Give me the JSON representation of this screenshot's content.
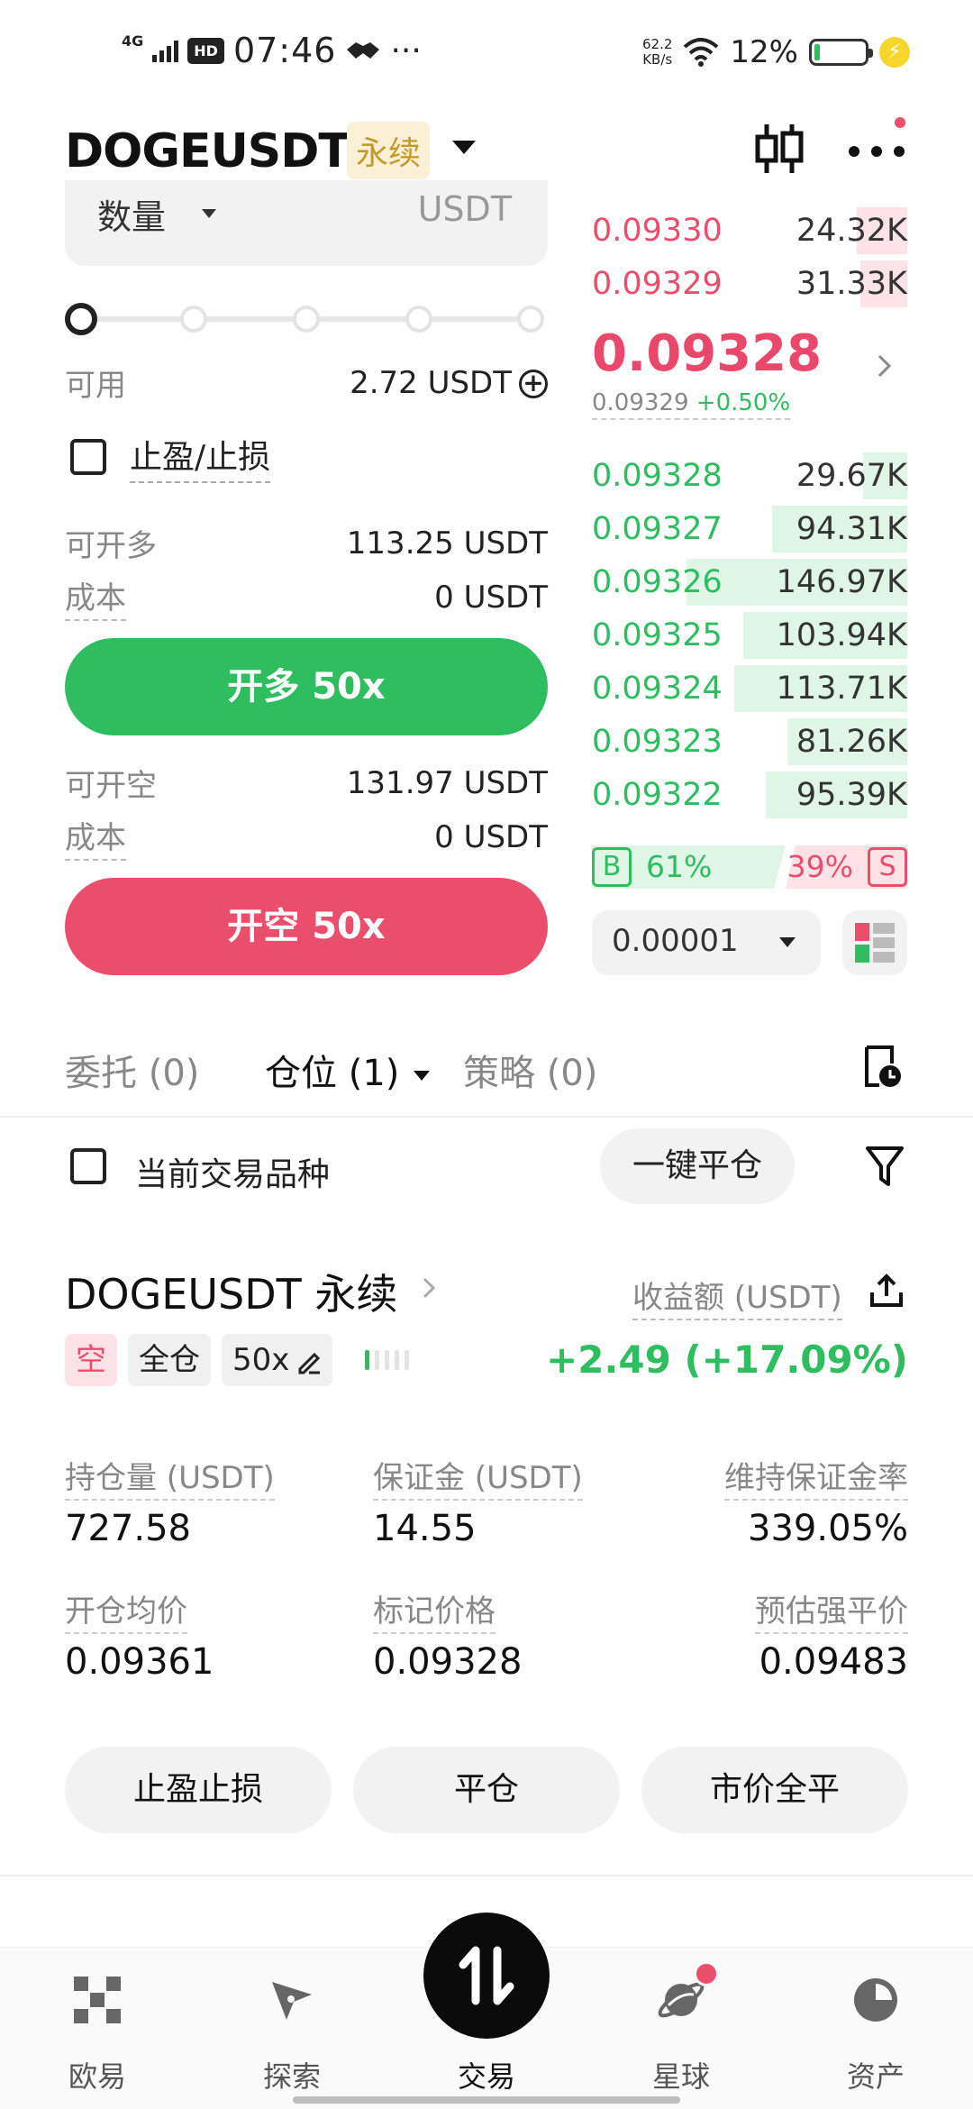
{
  "status_bar": {
    "network": "4G",
    "hd": "HD",
    "time": "07:46",
    "more": "···",
    "speed_value": "62.2",
    "speed_unit": "KB/s",
    "battery_pct": "12%",
    "battery_level": 0.12,
    "icons": [
      "signal-icon",
      "hd-icon",
      "handshake-icon",
      "wifi-icon",
      "battery-icon",
      "charging-icon"
    ]
  },
  "header": {
    "pair": "DOGEUSDT",
    "contract_type": "永续",
    "icons": [
      "dropdown-caret-icon",
      "candlestick-chart-icon",
      "more-icon"
    ]
  },
  "order_form": {
    "quantity_label": "数量",
    "quantity_unit": "USDT",
    "slider_position": 0,
    "available_label": "可用",
    "available_value": "2.72 USDT",
    "tpsl_label": "止盈/止损",
    "tpsl_checked": false,
    "can_long_label": "可开多",
    "can_long_value": "113.25 USDT",
    "long_cost_label": "成本",
    "long_cost_value": "0 USDT",
    "long_button": "开多 50x",
    "can_short_label": "可开空",
    "can_short_value": "131.97 USDT",
    "short_cost_label": "成本",
    "short_cost_value": "0 USDT",
    "short_button": "开空 50x"
  },
  "order_book": {
    "asks": [
      {
        "price": "0.09330",
        "amount": "24.32K",
        "depth": 0.16
      },
      {
        "price": "0.09329",
        "amount": "31.33K",
        "depth": 0.15
      }
    ],
    "last_price": "0.09328",
    "mark_price": "0.09329",
    "change": "+0.50%",
    "bids": [
      {
        "price": "0.09328",
        "amount": "29.67K",
        "depth": 0.14
      },
      {
        "price": "0.09327",
        "amount": "94.31K",
        "depth": 0.43
      },
      {
        "price": "0.09326",
        "amount": "146.97K",
        "depth": 0.7
      },
      {
        "price": "0.09325",
        "amount": "103.94K",
        "depth": 0.52
      },
      {
        "price": "0.09324",
        "amount": "113.71K",
        "depth": 0.55
      },
      {
        "price": "0.09323",
        "amount": "81.26K",
        "depth": 0.38
      },
      {
        "price": "0.09322",
        "amount": "95.39K",
        "depth": 0.45
      }
    ],
    "buy_label": "B",
    "buy_pct": "61%",
    "sell_pct": "39%",
    "sell_label": "S",
    "precision": "0.00001"
  },
  "tabs": {
    "orders": "委托 (0)",
    "positions": "仓位 (1)",
    "strategies": "策略 (0)"
  },
  "filter": {
    "current_symbol_label": "当前交易品种",
    "close_all_button": "一键平仓"
  },
  "position": {
    "title": "DOGEUSDT 永续",
    "pnl_label": "收益额 (USDT)",
    "side_tag": "空",
    "margin_mode_tag": "全仓",
    "leverage_tag": "50x",
    "pnl_value": "+2.49 (+17.09%)",
    "stats": [
      {
        "label": "持仓量 (USDT)",
        "value": "727.58"
      },
      {
        "label": "保证金 (USDT)",
        "value": "14.55"
      },
      {
        "label": "维持保证金率",
        "value": "339.05%"
      },
      {
        "label": "开仓均价",
        "value": "0.09361"
      },
      {
        "label": "标记价格",
        "value": "0.09328"
      },
      {
        "label": "预估强平价",
        "value": "0.09483"
      }
    ],
    "actions": [
      "止盈止损",
      "平仓",
      "市价全平"
    ]
  },
  "bottom_nav": [
    {
      "label": "欧易",
      "icon": "okx-logo-icon"
    },
    {
      "label": "探索",
      "icon": "compass-icon"
    },
    {
      "label": "交易",
      "icon": "trade-swap-icon"
    },
    {
      "label": "星球",
      "icon": "planet-icon"
    },
    {
      "label": "资产",
      "icon": "pie-chart-icon"
    }
  ],
  "colors": {
    "green": "#2ebd5f",
    "red": "#ea4e6b",
    "gold_tag": "#c39a2a"
  }
}
